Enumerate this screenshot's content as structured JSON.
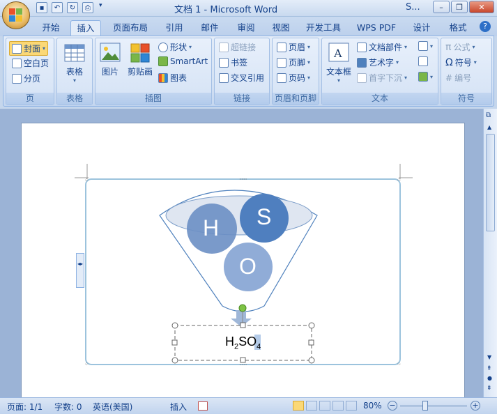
{
  "window": {
    "title": "文档 1 - Microsoft Word",
    "title_extra": "S..."
  },
  "tabs": [
    "开始",
    "插入",
    "页面布局",
    "引用",
    "邮件",
    "审阅",
    "视图",
    "开发工具",
    "WPS PDF",
    "设计",
    "格式"
  ],
  "active_tab": "插入",
  "ribbon": {
    "page_group": {
      "label": "页",
      "cover": "封面",
      "blank": "空白页",
      "break": "分页"
    },
    "table_group": {
      "label": "表格",
      "table": "表格"
    },
    "illus_group": {
      "label": "插图",
      "picture": "图片",
      "clipart": "剪贴画",
      "shapes": "形状",
      "smartart": "SmartArt",
      "chart": "图表"
    },
    "links_group": {
      "label": "链接",
      "hyperlink": "超链接",
      "bookmark": "书签",
      "crossref": "交叉引用"
    },
    "hf_group": {
      "label": "页眉和页脚",
      "header": "页眉",
      "footer": "页脚",
      "pagenum": "页码"
    },
    "text_group": {
      "label": "文本",
      "textbox": "文本框",
      "quickparts": "文档部件",
      "wordart": "艺术字",
      "dropcap": "首字下沉"
    },
    "symbol_group": {
      "label": "符号",
      "equation": "公式",
      "symbol": "符号",
      "numbering": "编号"
    }
  },
  "diagram": {
    "circle_h": "H",
    "circle_s": "S",
    "circle_o": "O",
    "result_main": "H",
    "sub1": "2",
    "mid": "SO",
    "sub2": "4"
  },
  "status": {
    "page": "页面: 1/1",
    "words": "字数: 0",
    "lang": "英语(美国)",
    "mode": "插入",
    "zoom": "80%"
  },
  "colors": {
    "accent": "#4f81bd",
    "light": "#95b3d7",
    "ribbon": "#dbe6f5"
  }
}
